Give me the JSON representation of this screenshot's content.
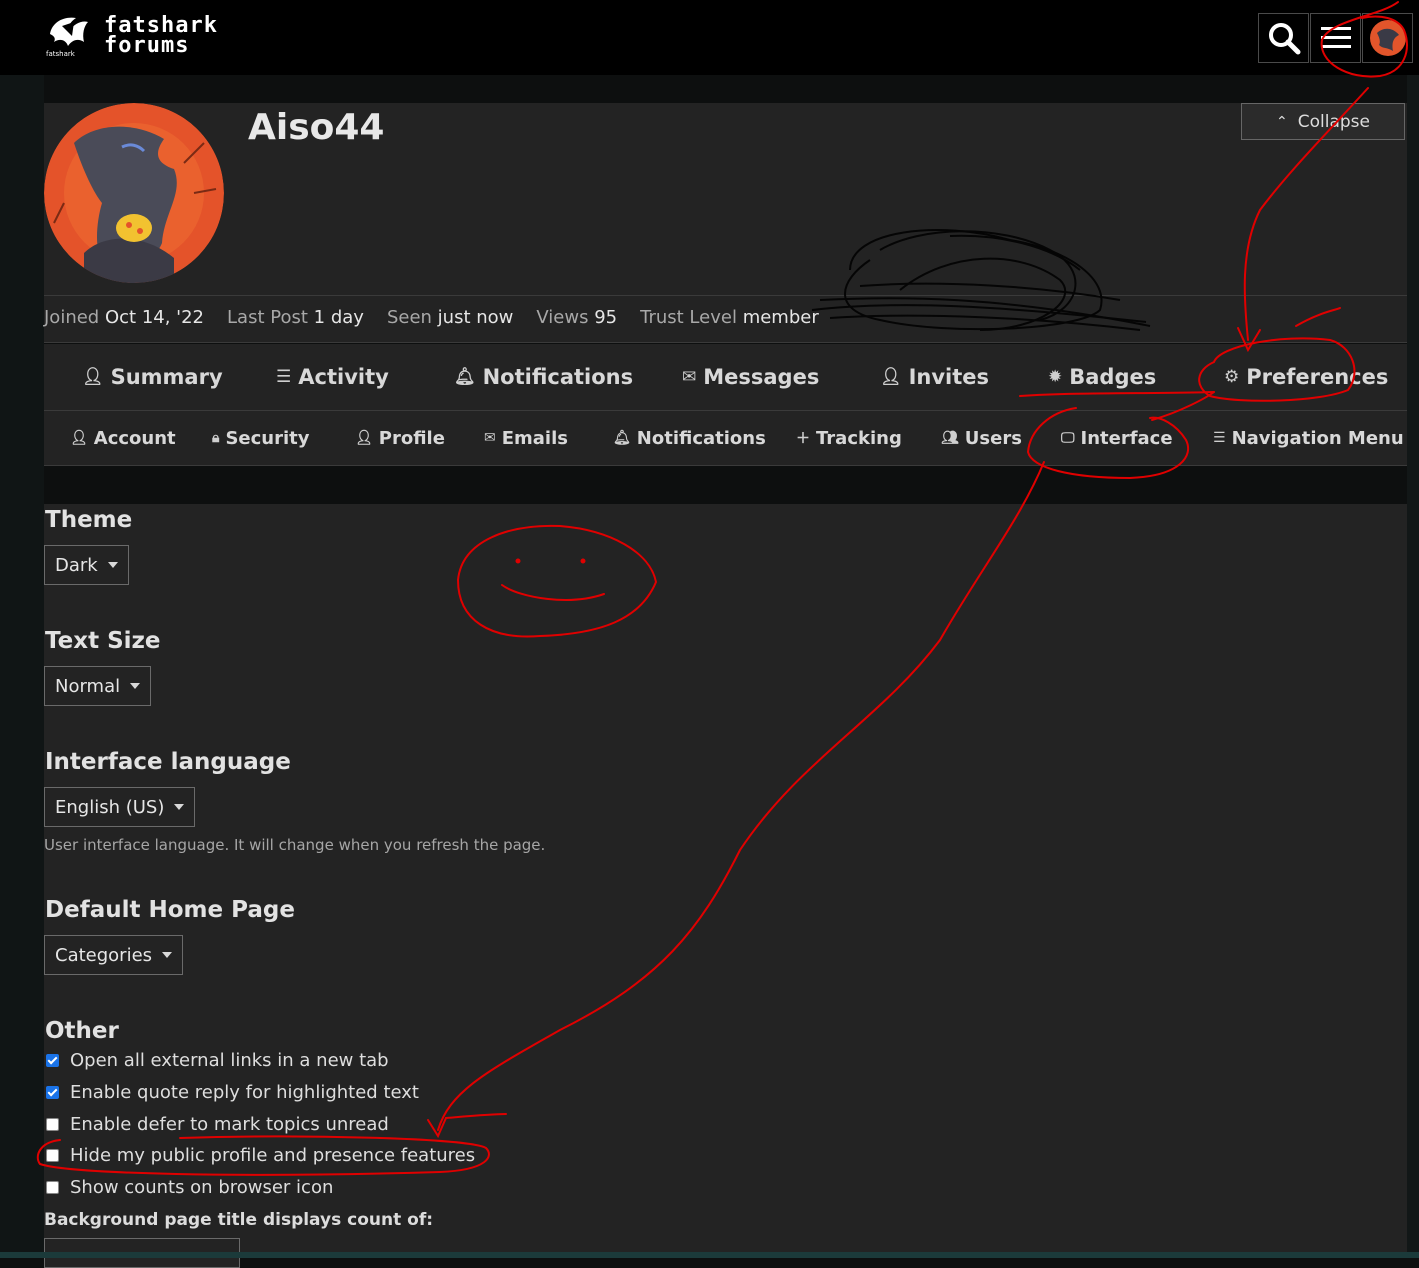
{
  "header": {
    "logo_text_line1": "fatshark",
    "logo_text_line2": "forums",
    "logo_small": "fatshark",
    "icons": [
      "search-icon",
      "hamburger-menu-icon",
      "user-avatar-icon"
    ]
  },
  "profile": {
    "username": "Aiso44",
    "collapse_label": "Collapse",
    "stats": [
      {
        "label": "Joined",
        "value": "Oct 14, '22"
      },
      {
        "label": "Last Post",
        "value": "1 day"
      },
      {
        "label": "Seen",
        "value": "just now"
      },
      {
        "label": "Views",
        "value": "95"
      },
      {
        "label": "Trust Level",
        "value": "member"
      }
    ]
  },
  "main_tabs": [
    {
      "label": "Summary",
      "icon": "user-icon"
    },
    {
      "label": "Activity",
      "icon": "list-icon"
    },
    {
      "label": "Notifications",
      "icon": "bell-icon"
    },
    {
      "label": "Messages",
      "icon": "envelope-icon"
    },
    {
      "label": "Invites",
      "icon": "user-plus-icon"
    },
    {
      "label": "Badges",
      "icon": "badge-icon"
    },
    {
      "label": "Preferences",
      "icon": "gear-icon"
    }
  ],
  "pref_tabs": [
    {
      "label": "Account",
      "icon": "user-icon"
    },
    {
      "label": "Security",
      "icon": "lock-icon"
    },
    {
      "label": "Profile",
      "icon": "user-icon"
    },
    {
      "label": "Emails",
      "icon": "envelope-icon"
    },
    {
      "label": "Notifications",
      "icon": "bell-icon"
    },
    {
      "label": "Tracking",
      "icon": "plus-icon"
    },
    {
      "label": "Users",
      "icon": "users-icon"
    },
    {
      "label": "Interface",
      "icon": "desktop-icon"
    },
    {
      "label": "Navigation Menu",
      "icon": "list-icon"
    }
  ],
  "interface": {
    "theme": {
      "title": "Theme",
      "value": "Dark"
    },
    "text_size": {
      "title": "Text Size",
      "value": "Normal"
    },
    "language": {
      "title": "Interface language",
      "value": "English (US)",
      "hint": "User interface language. It will change when you refresh the page."
    },
    "home_page": {
      "title": "Default Home Page",
      "value": "Categories"
    },
    "other": {
      "title": "Other",
      "options": [
        {
          "label": "Open all external links in a new tab",
          "checked": true
        },
        {
          "label": "Enable quote reply for highlighted text",
          "checked": true
        },
        {
          "label": "Enable defer to mark topics unread",
          "checked": false
        },
        {
          "label": "Hide my public profile and presence features",
          "checked": false
        },
        {
          "label": "Show counts on browser icon",
          "checked": false
        }
      ]
    },
    "bg_title": {
      "title": "Background page title displays count of:"
    }
  },
  "colors": {
    "annotation": "#e00000",
    "checkbox_accent": "#1a73e8",
    "panel_bg": "#232323"
  }
}
